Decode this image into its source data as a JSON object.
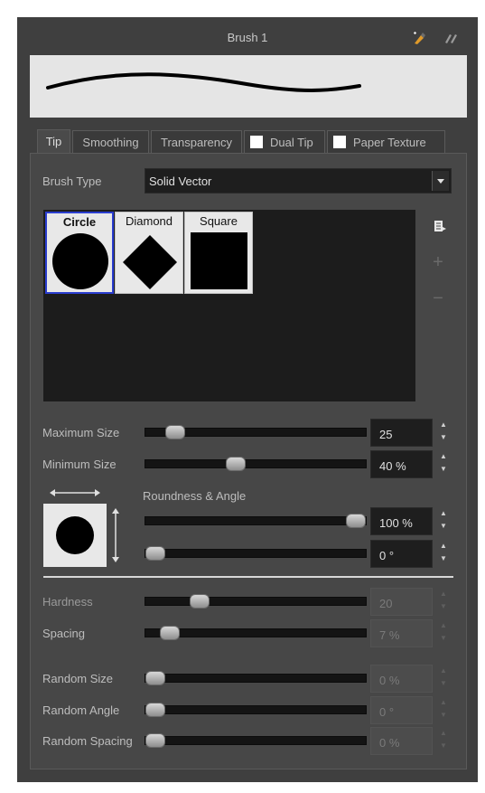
{
  "window": {
    "title": "Brush 1"
  },
  "header_icons": [
    "new-brush-icon",
    "brush-options-icon"
  ],
  "tabs": [
    {
      "label": "Tip",
      "active": true,
      "checkbox": false
    },
    {
      "label": "Smoothing",
      "active": false,
      "checkbox": false
    },
    {
      "label": "Transparency",
      "active": false,
      "checkbox": false
    },
    {
      "label": "Dual Tip",
      "active": false,
      "checkbox": true
    },
    {
      "label": "Paper Texture",
      "active": false,
      "checkbox": true
    }
  ],
  "brush_type": {
    "label": "Brush Type",
    "value": "Solid Vector"
  },
  "tips": [
    {
      "name": "Circle",
      "shape": "circle",
      "selected": true
    },
    {
      "name": "Diamond",
      "shape": "diamond",
      "selected": false
    },
    {
      "name": "Square",
      "shape": "square",
      "selected": false
    }
  ],
  "size": {
    "max": {
      "label": "Maximum Size",
      "value": "25",
      "level": 0.1
    },
    "min": {
      "label": "Minimum Size",
      "value": "40 %",
      "level": 0.4
    }
  },
  "roundness_angle": {
    "label": "Roundness & Angle",
    "roundness": {
      "value": "100 %",
      "level": 1.0
    },
    "angle": {
      "value": "0 °",
      "level": 0.0
    }
  },
  "hardness": {
    "label": "Hardness",
    "value": "20",
    "level": 0.22
  },
  "spacing": {
    "label": "Spacing",
    "value": "7 %",
    "level": 0.07
  },
  "random_size": {
    "label": "Random Size",
    "value": "0 %",
    "level": 0.0
  },
  "random_angle": {
    "label": "Random Angle",
    "value": "0 °",
    "level": 0.0
  },
  "random_spacing": {
    "label": "Random Spacing",
    "value": "0 %",
    "level": 0.0
  },
  "colors": {
    "panel_bg": "#3f3f3f",
    "content_bg": "#474747",
    "field_bg": "#1e1e1e",
    "selection_border": "#2a3dcf",
    "preview_bg": "#e5e5e5"
  }
}
